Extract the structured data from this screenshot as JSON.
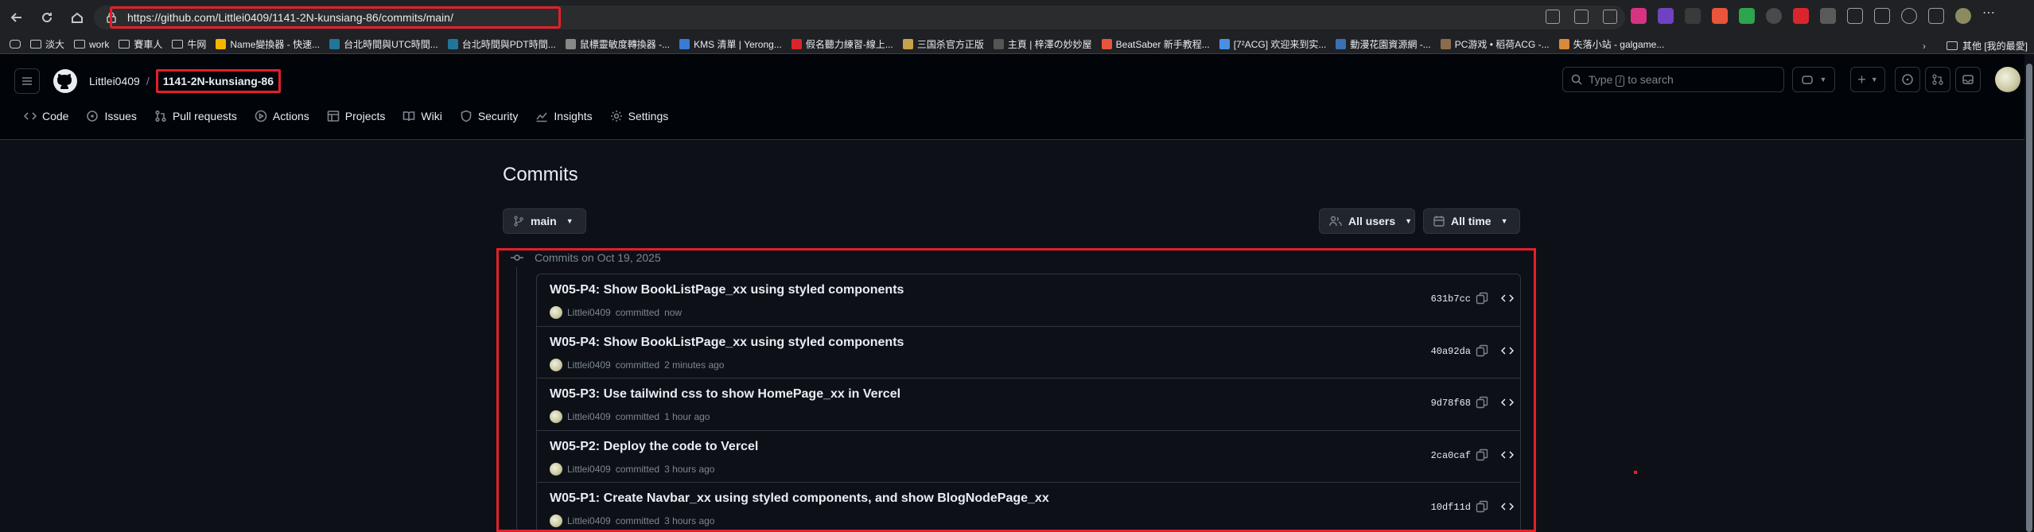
{
  "browser": {
    "url": "https://github.com/Littlei0409/1141-2N-kunsiang-86/commits/main/"
  },
  "bookmarks": [
    {
      "label": "淡大",
      "type": "folder"
    },
    {
      "label": "work",
      "type": "folder"
    },
    {
      "label": "賽車人",
      "type": "folder"
    },
    {
      "label": "牛网",
      "type": "folder"
    },
    {
      "label": "Name變換器 - 快速...",
      "type": "link",
      "color": "#f7b500"
    },
    {
      "label": "台北時間與UTC時間...",
      "type": "link",
      "color": "#21759b"
    },
    {
      "label": "台北時間與PDT時間...",
      "type": "link",
      "color": "#21759b"
    },
    {
      "label": "鼠標靈敏度轉換器 -...",
      "type": "link",
      "color": "#888888"
    },
    {
      "label": "KMS 清單 | Yerong...",
      "type": "link",
      "color": "#3a7bd5"
    },
    {
      "label": "假名聽力練習-線上...",
      "type": "link",
      "color": "#d9262c"
    },
    {
      "label": "三国杀官方正版",
      "type": "link",
      "color": "#c8a24a"
    },
    {
      "label": "主頁 | 梓澤の妙妙屋",
      "type": "link",
      "color": "#555555"
    },
    {
      "label": "BeatSaber 新手教程...",
      "type": "link",
      "color": "#e8553a"
    },
    {
      "label": "[7²ACG] 欢迎来到实...",
      "type": "link",
      "color": "#4a90e2"
    },
    {
      "label": "動漫花園資源網 -...",
      "type": "link",
      "color": "#3b6fb6"
    },
    {
      "label": "PC游戏 • 稻荷ACG -...",
      "type": "link",
      "color": "#8a6d4b"
    },
    {
      "label": "失落小站 - galgame...",
      "type": "link",
      "color": "#d98b3a"
    }
  ],
  "bookmarks_other": "其他 [我的最愛]",
  "repo": {
    "owner": "Littlei0409",
    "separator": "/",
    "name": "1141-2N-kunsiang-86"
  },
  "search": {
    "prefix": "Type",
    "key": "/",
    "suffix": "to search"
  },
  "tabs": [
    {
      "label": "Code",
      "icon": "code-icon"
    },
    {
      "label": "Issues",
      "icon": "issue-icon"
    },
    {
      "label": "Pull requests",
      "icon": "pull-request-icon"
    },
    {
      "label": "Actions",
      "icon": "play-icon"
    },
    {
      "label": "Projects",
      "icon": "table-icon"
    },
    {
      "label": "Wiki",
      "icon": "book-icon"
    },
    {
      "label": "Security",
      "icon": "shield-icon"
    },
    {
      "label": "Insights",
      "icon": "graph-icon"
    },
    {
      "label": "Settings",
      "icon": "gear-icon"
    }
  ],
  "page": {
    "title": "Commits",
    "branch": "main",
    "users_filter": "All users",
    "time_filter": "All time",
    "group_label": "Commits on Oct 19, 2025"
  },
  "commits": [
    {
      "title": "W05-P4: Show BookListPage_xx using styled components",
      "author": "Littlei0409",
      "verb": "committed",
      "time": "now",
      "sha": "631b7cc"
    },
    {
      "title": "W05-P4: Show BookListPage_xx using styled components",
      "author": "Littlei0409",
      "verb": "committed",
      "time": "2 minutes ago",
      "sha": "40a92da"
    },
    {
      "title": "W05-P3: Use tailwind css to show HomePage_xx in Vercel",
      "author": "Littlei0409",
      "verb": "committed",
      "time": "1 hour ago",
      "sha": "9d78f68"
    },
    {
      "title": "W05-P2: Deploy the code to Vercel",
      "author": "Littlei0409",
      "verb": "committed",
      "time": "3 hours ago",
      "sha": "2ca0caf"
    },
    {
      "title": "W05-P1: Create Navbar_xx using styled components, and show BlogNodePage_xx",
      "author": "Littlei0409",
      "verb": "committed",
      "time": "3 hours ago",
      "sha": "10df11d"
    }
  ],
  "colors": {
    "highlight": "#e2202a",
    "background": "#0d1117",
    "header": "#010409",
    "border": "#30363d",
    "muted": "#7d8590"
  }
}
